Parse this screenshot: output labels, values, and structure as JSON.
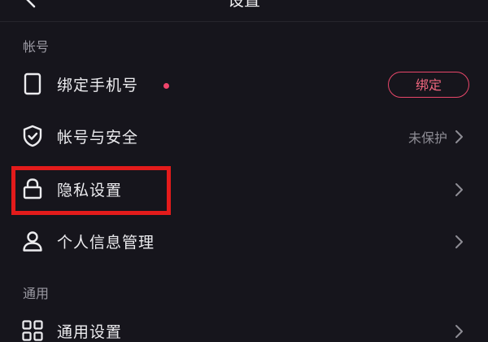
{
  "header": {
    "title": "设置",
    "back_icon": "chevron-left-icon"
  },
  "sections": [
    {
      "title": "帐号",
      "items": [
        {
          "label": "绑定手机号",
          "icon": "phone-icon",
          "has_dot": true,
          "action_button": "绑定"
        },
        {
          "label": "帐号与安全",
          "icon": "shield-check-icon",
          "status": "未保护"
        },
        {
          "label": "隐私设置",
          "icon": "lock-icon",
          "highlighted": true
        },
        {
          "label": "个人信息管理",
          "icon": "user-icon"
        }
      ]
    },
    {
      "title": "通用",
      "items": [
        {
          "label": "通用设置",
          "icon": "grid-icon"
        }
      ]
    }
  ],
  "colors": {
    "background": "#16151c",
    "accent": "#e8476a",
    "highlight_box": "#e31b1b",
    "secondary_text": "#8e8d95"
  }
}
